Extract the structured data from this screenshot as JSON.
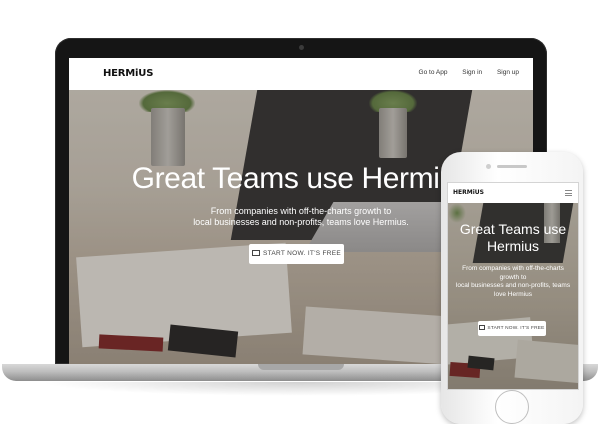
{
  "brand": {
    "logo_text": "HERMiUS"
  },
  "laptop": {
    "nav": {
      "links": [
        "Go to App",
        "Sign in",
        "Sign up"
      ]
    },
    "hero": {
      "title": "Great Teams use Hermius",
      "subtitle_lines": [
        "From companies with off-the-charts growth to",
        "local businesses and non-profits, teams love Hermius."
      ],
      "cta_label": "START NOW. IT'S FREE"
    }
  },
  "phone": {
    "hero": {
      "title_lines": [
        "Great Teams use",
        "Hermius"
      ],
      "subtitle_lines": [
        "From companies with off-the-charts",
        "growth to",
        "local businesses and non-profits, teams",
        "love Hermius"
      ],
      "cta_label": "START NOW. IT'S FREE"
    }
  },
  "icons": {
    "cta": "laptop-icon",
    "menu": "hamburger-icon"
  }
}
